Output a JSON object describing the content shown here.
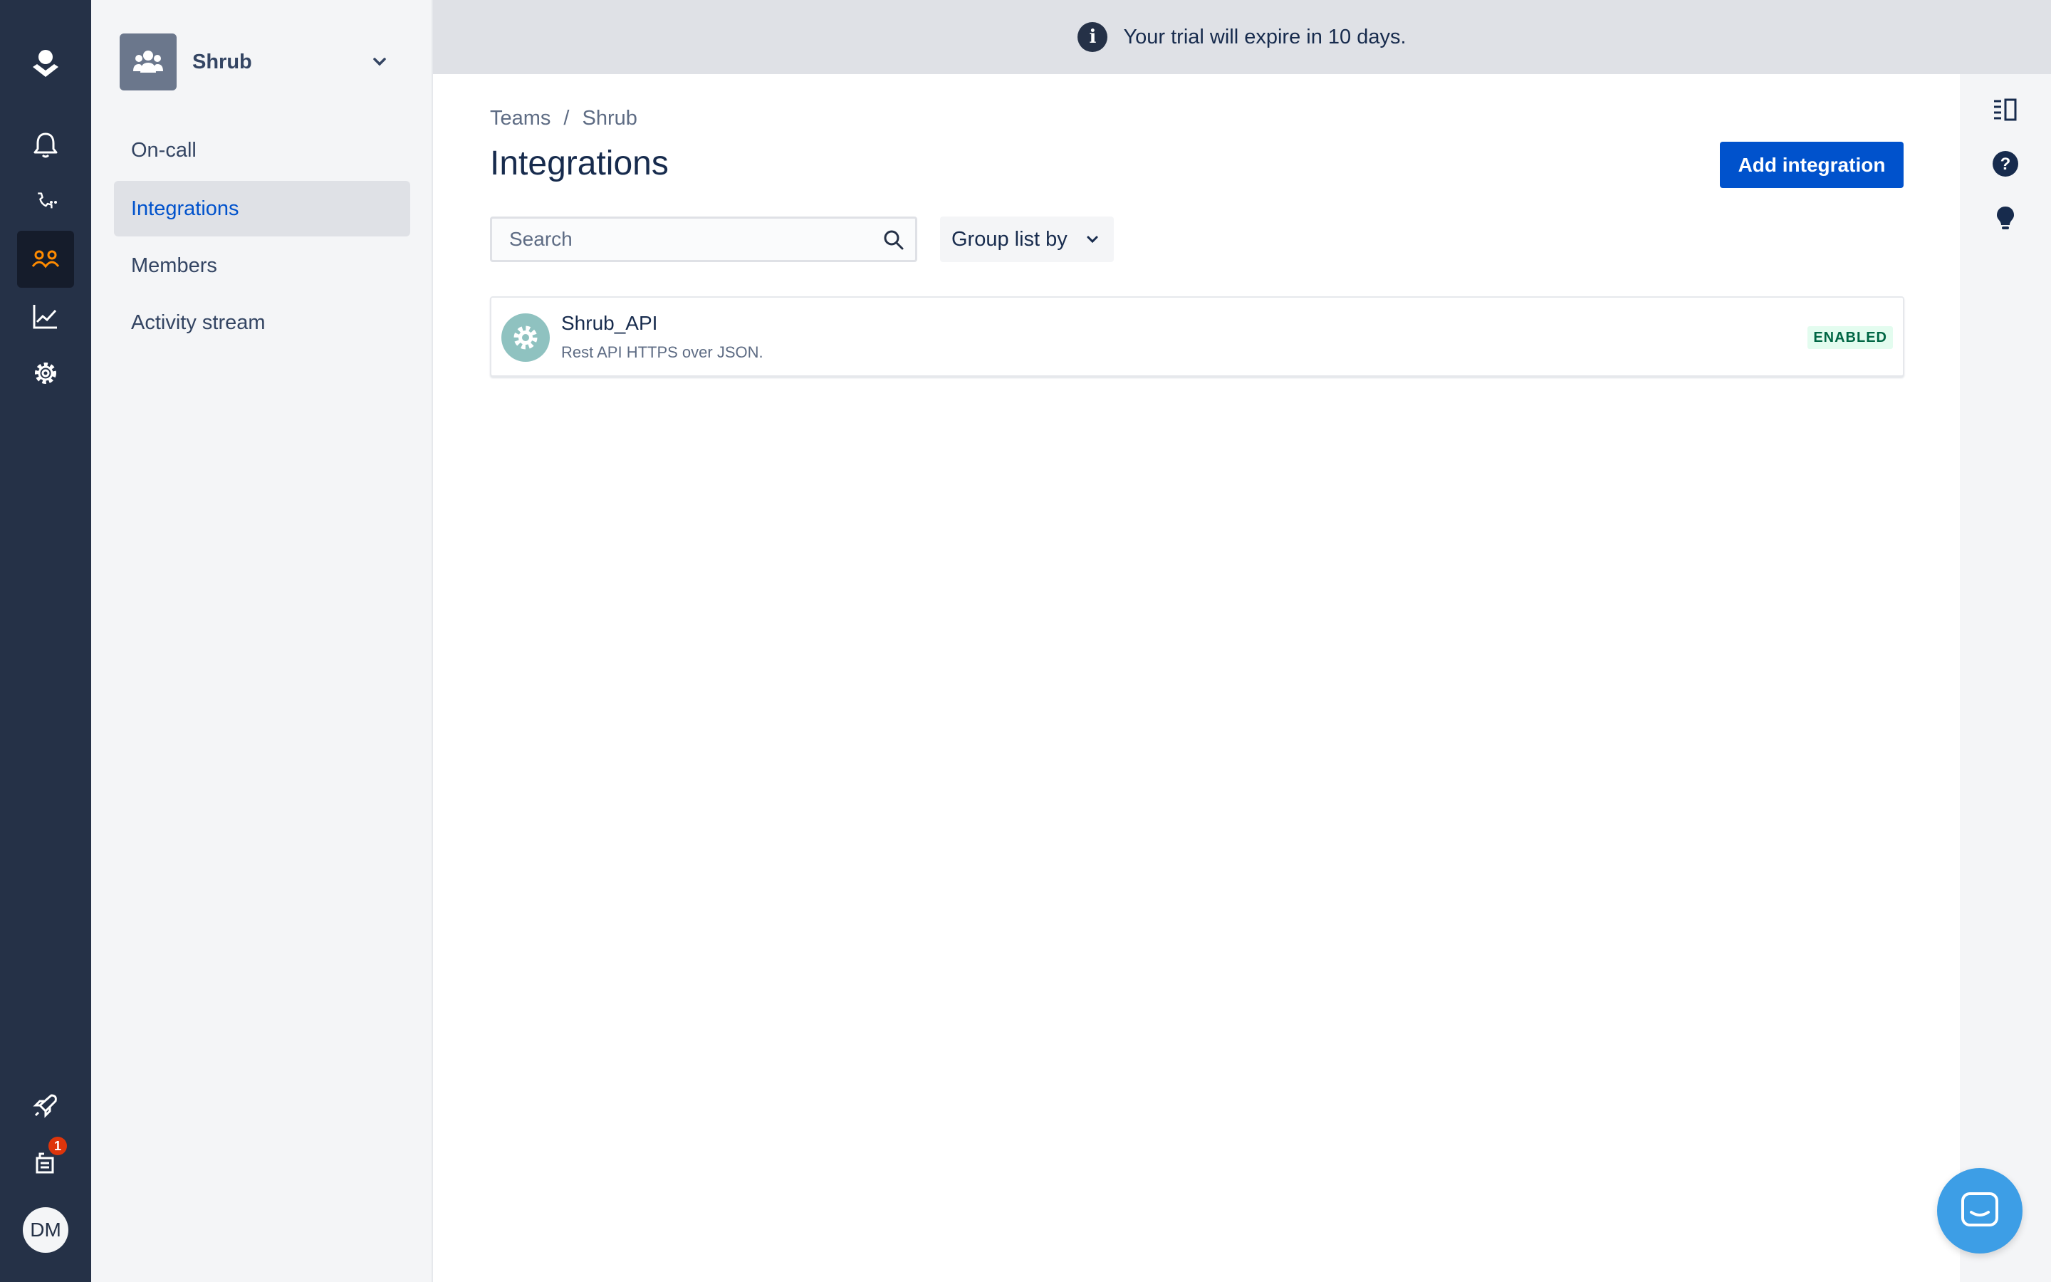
{
  "banner": {
    "text": "Your trial will expire in 10 days."
  },
  "global_nav": {
    "items": [
      {
        "name": "alerts",
        "icon": "bell-icon"
      },
      {
        "name": "on-call",
        "icon": "phone-icon"
      },
      {
        "name": "teams",
        "icon": "teams-icon",
        "active": true
      },
      {
        "name": "analytics",
        "icon": "chart-icon"
      },
      {
        "name": "settings",
        "icon": "gear-icon"
      }
    ],
    "bottom": {
      "whats_new_icon": "rocket-icon",
      "notifications_badge": "1",
      "avatar_initials": "DM"
    },
    "active_color": "#ff8b00"
  },
  "team_sidebar": {
    "team_name": "Shrub",
    "items": [
      {
        "label": "On-call"
      },
      {
        "label": "Integrations",
        "active": true
      },
      {
        "label": "Members"
      },
      {
        "label": "Activity stream"
      }
    ]
  },
  "main": {
    "breadcrumb": [
      "Teams",
      "/",
      "Shrub"
    ],
    "title": "Integrations",
    "add_button_label": "Add integration",
    "search_placeholder": "Search",
    "group_label": "Group list by",
    "integrations": [
      {
        "name": "Shrub_API",
        "description": "Rest API HTTPS over JSON.",
        "status": "ENABLED"
      }
    ]
  },
  "colors": {
    "primary": "#0052cc",
    "nav_bg": "#253147",
    "enabled_bg": "#e3fcef",
    "enabled_text": "#006644"
  }
}
